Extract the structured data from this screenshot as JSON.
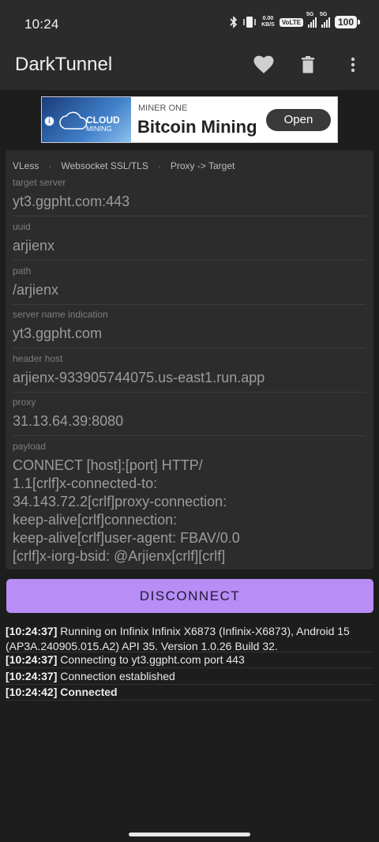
{
  "status_bar": {
    "time": "10:24",
    "net_speed_value": "0.00",
    "net_speed_unit": "KB/S",
    "volte": "VoLTE",
    "sim1": "5G",
    "sim2": "5G",
    "battery": "100"
  },
  "app_bar": {
    "title": "DarkTunnel",
    "actions": [
      "heart-icon",
      "trash-icon",
      "more-vert-icon"
    ]
  },
  "ad": {
    "image_title": "CLOUD",
    "image_subtitle": "MINING",
    "sponsor": "MINER ONE",
    "headline": "Bitcoin Mining",
    "cta": "Open"
  },
  "config": {
    "protocol": "VLess",
    "transport": "Websocket SSL/TLS",
    "mode": "Proxy -> Target",
    "fields": [
      {
        "label": "target server",
        "value": "yt3.ggpht.com:443"
      },
      {
        "label": "uuid",
        "value": "arjienx"
      },
      {
        "label": "path",
        "value": "/arjienx"
      },
      {
        "label": "server name indication",
        "value": "yt3.ggpht.com"
      },
      {
        "label": "header host",
        "value": "arjienx-933905744075.us-east1.run.app"
      },
      {
        "label": "proxy",
        "value": "31.13.64.39:8080"
      },
      {
        "label": "payload",
        "value_lines": [
          "CONNECT [host]:[port] HTTP/",
          "1.1[crlf]x-connected-to:",
          "34.143.72.2[crlf]proxy-connection:",
          "keep-alive[crlf]connection:",
          "keep-alive[crlf]user-agent: FBAV/0.0",
          "[crlf]x-iorg-bsid: @Arjienx[crlf][crlf]"
        ]
      }
    ]
  },
  "disconnect_label": "DISCONNECT",
  "logs": [
    {
      "time": "[10:24:37]",
      "lines": [
        "Running on Infinix Infinix X6873 (Infinix-X6873), Android 15",
        "(AP3A.240905.015.A2) API 35. Version 1.0.26 Build 32."
      ]
    },
    {
      "time": "[10:24:37]",
      "lines": [
        "Connecting to yt3.ggpht.com port 443"
      ]
    },
    {
      "time": "[10:24:37]",
      "lines": [
        "Connection established"
      ]
    },
    {
      "time": "[10:24:42]",
      "lines": [
        "Connected"
      ],
      "bold": true
    }
  ],
  "colors": {
    "background": "#1d1d1d",
    "bar": "#2b2b2b",
    "card": "#2c2c2c",
    "accent": "#b88df6"
  }
}
